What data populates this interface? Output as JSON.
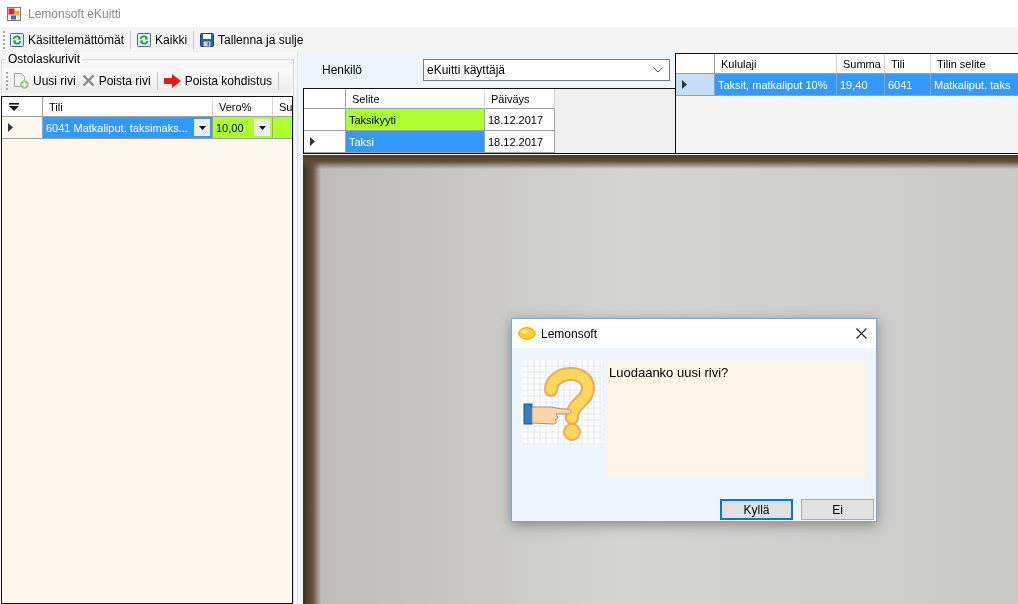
{
  "window": {
    "title": "Lemonsoft eKuitti"
  },
  "toolbar": [
    "Käsittelemättömät",
    "Kaikki",
    "Tallenna ja sulje"
  ],
  "purchase_lines": {
    "title": "Ostolaskurivit",
    "toolbar": [
      "Uusi rivi",
      "Poista rivi",
      "Poista kohdistus"
    ],
    "table": {
      "columns": [
        "Tili",
        "Vero%",
        "Su"
      ],
      "rows": [
        {
          "current": true,
          "selected": false,
          "cells": [
            {
              "value": "6041 Matkaliput. taksimaks...",
              "selected": true,
              "dropdown": true
            },
            {
              "value": "10,00",
              "selected": false,
              "highlighted": true,
              "dropdown": true
            },
            {
              "selected": false,
              "highlighted": true,
              "dropdown": false
            }
          ]
        }
      ]
    }
  },
  "person": {
    "label": "Henkilö",
    "value": "eKuitti käyttäjä"
  },
  "receipts_table": {
    "columns": [
      "Selite",
      "Päiväys"
    ],
    "rows": [
      {
        "current": false,
        "selected": false,
        "cells": [
          {
            "value": "Taksikyyti",
            "selected": false,
            "highlighted": true
          },
          {
            "value": "18.12.2017",
            "selected": false,
            "highlighted": false
          }
        ]
      },
      {
        "current": true,
        "selected": false,
        "cells": [
          {
            "value": "Taksi",
            "selected": true
          },
          {
            "value": "18.12.2017",
            "selected": false,
            "highlighted": false
          }
        ]
      }
    ]
  },
  "expense_table": {
    "columns": [
      "Kululaji",
      "Summa",
      "Tili",
      "Tilin selite"
    ],
    "rows": [
      {
        "current": true,
        "selected": true,
        "cells": [
          {
            "value": "Taksit, matkaliput 10%",
            "selected": true
          },
          {
            "value": "19,40",
            "selected": true
          },
          {
            "value": "6041",
            "selected": true
          },
          {
            "value": "Matkaliput. taks",
            "selected": true
          }
        ]
      }
    ]
  },
  "dialog": {
    "title": "Lemonsoft",
    "message": "Luodaanko uusi rivi?",
    "buttons": [
      {
        "label": "Kyllä",
        "focused": true
      },
      {
        "label": "Ei",
        "focused": false
      }
    ]
  }
}
